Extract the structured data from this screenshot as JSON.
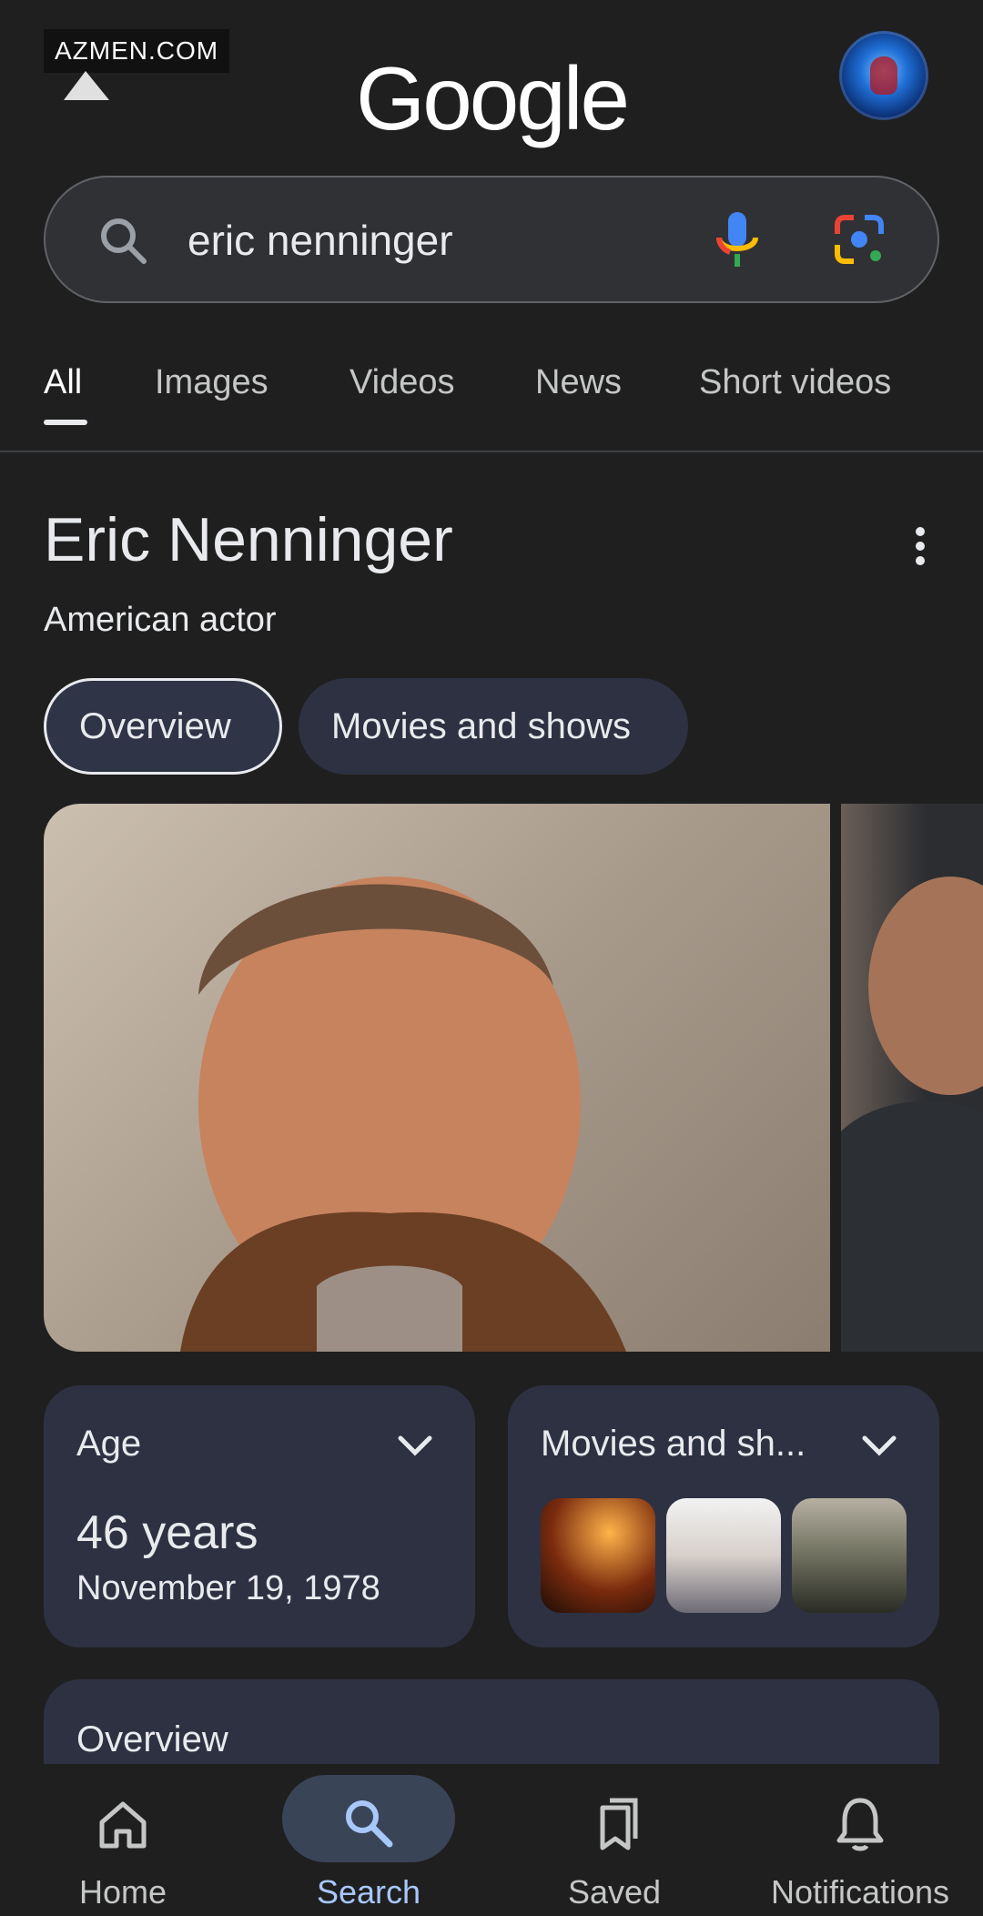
{
  "watermark": "AZMEN.COM",
  "header": {
    "logo_text": "Google"
  },
  "search": {
    "query": "eric nenninger"
  },
  "tabs": [
    {
      "label": "All"
    },
    {
      "label": "Images"
    },
    {
      "label": "Videos"
    },
    {
      "label": "News"
    },
    {
      "label": "Short videos"
    }
  ],
  "knowledge_panel": {
    "title": "Eric Nenninger",
    "subtitle": "American actor",
    "chips": [
      {
        "label": "Overview"
      },
      {
        "label": "Movies and shows"
      }
    ],
    "age_card": {
      "label": "Age",
      "value": "46 years",
      "date": "November 19, 1978"
    },
    "movies_card": {
      "label": "Movies and sh..."
    },
    "overview_card": {
      "label": "Overview"
    }
  },
  "bottom_nav": [
    {
      "label": "Home",
      "icon": "home-icon"
    },
    {
      "label": "Search",
      "icon": "search-icon"
    },
    {
      "label": "Saved",
      "icon": "bookmarks-icon"
    },
    {
      "label": "Notifications",
      "icon": "bell-icon"
    }
  ],
  "colors": {
    "background": "#1f1f1f",
    "card": "#2d3142",
    "accent_active": "#a8c7fa"
  }
}
